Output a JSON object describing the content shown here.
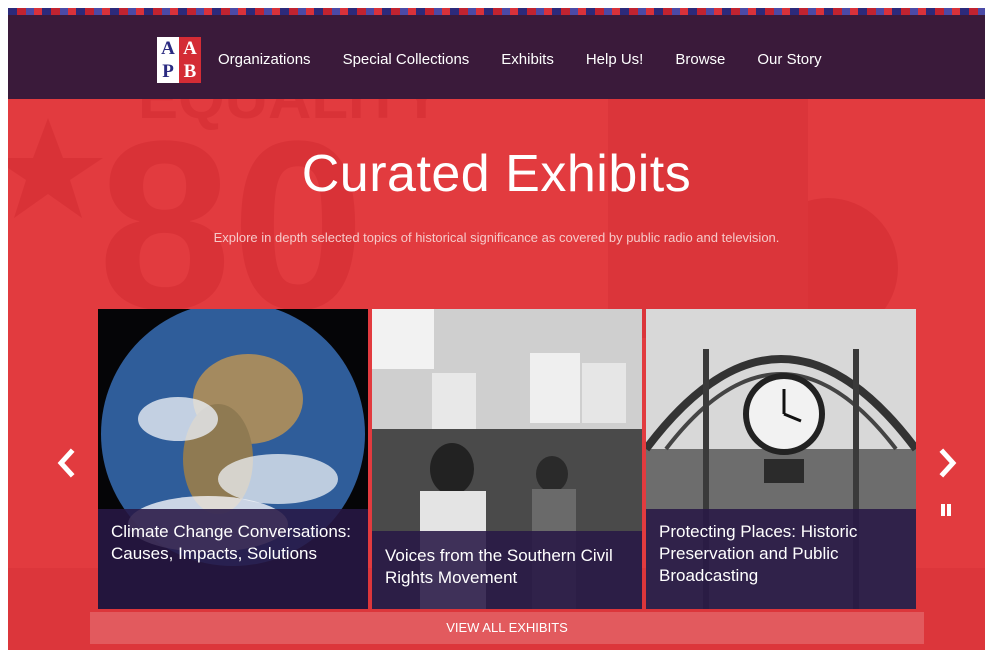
{
  "logo": {
    "letters": [
      "A",
      "A",
      "P",
      "B"
    ]
  },
  "nav": {
    "items": [
      {
        "label": "Organizations"
      },
      {
        "label": "Special Collections"
      },
      {
        "label": "Exhibits"
      },
      {
        "label": "Help Us!"
      },
      {
        "label": "Browse"
      },
      {
        "label": "Our Story"
      }
    ]
  },
  "hero": {
    "title": "Curated Exhibits",
    "subtitle": "Explore in depth selected topics of historical significance as covered by public radio and television."
  },
  "carousel": {
    "prev_icon": "chevron-left-icon",
    "next_icon": "chevron-right-icon",
    "pause_icon": "pause-icon",
    "cards": [
      {
        "caption": "Climate Change Conversations: Causes, Impacts, Solutions"
      },
      {
        "caption": "Voices from the Southern Civil Rights Movement"
      },
      {
        "caption": "Protecting Places: Historic Preservation and Public Broadcasting"
      }
    ],
    "view_all_label": "VIEW ALL EXHIBITS"
  },
  "colors": {
    "accent_red": "#e23b3f",
    "nav_bg": "#3a1a3a",
    "caption_bg": "#28184a"
  }
}
